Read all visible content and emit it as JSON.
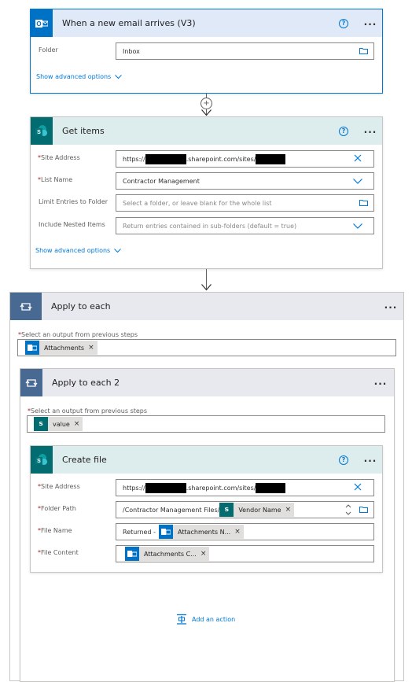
{
  "trigger": {
    "title": "When a new email arrives (V3)",
    "folder_label": "Folder",
    "folder_value": "Inbox",
    "advanced_link": "Show advanced options"
  },
  "get_items": {
    "title": "Get items",
    "site_label": "Site Address",
    "site_prefix": "https://",
    "site_middle": ".sharepoint.com/sites/",
    "list_label": "List Name",
    "list_value": "Contractor Management",
    "limit_label": "Limit Entries to Folder",
    "limit_placeholder": "Select a folder, or leave blank for the whole list",
    "nested_label": "Include Nested Items",
    "nested_placeholder": "Return entries contained in sub-folders (default = true)",
    "advanced_link": "Show advanced options"
  },
  "apply_each": {
    "title": "Apply to each",
    "select_label": "Select an output from previous steps",
    "token": "Attachments"
  },
  "apply_each_2": {
    "title": "Apply to each 2",
    "select_label": "Select an output from previous steps",
    "token": "value"
  },
  "create_file": {
    "title": "Create file",
    "site_label": "Site Address",
    "site_prefix": "https://",
    "site_middle": ".sharepoint.com/sites/",
    "folder_label": "Folder Path",
    "folder_prefix": "/Contractor Management Files/",
    "folder_token": "Vendor Name",
    "filename_label": "File Name",
    "filename_prefix": "Returned -",
    "filename_token": "Attachments N...",
    "content_label": "File Content",
    "content_token": "Attachments C..."
  },
  "add_action": "Add an action",
  "required_marker": "*",
  "help_glyph": "?",
  "more_glyph": "···",
  "plus_glyph": "+",
  "close_glyph": "×",
  "sp_letter": "s",
  "colors": {
    "trigger_header": "#dfe9f7",
    "sharepoint_header": "#ddecec",
    "loop_header": "#e8e9ee",
    "accent": "#0078d4",
    "sharepoint": "#036c70",
    "loop": "#486991"
  },
  "icons": [
    "outlook-icon",
    "sharepoint-icon",
    "loop-icon",
    "help-icon",
    "more-icon",
    "folder-icon",
    "chevron-down-icon",
    "close-icon",
    "plus-icon",
    "arrow-down-icon",
    "add-action-icon"
  ]
}
